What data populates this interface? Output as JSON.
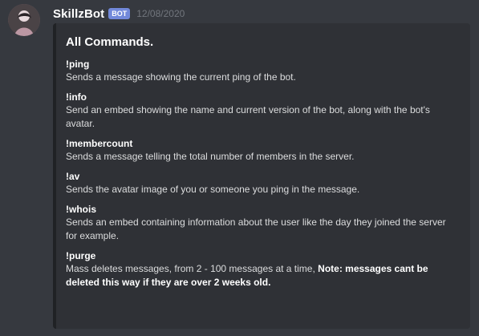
{
  "message": {
    "author": "SkillzBot",
    "bot_tag": "BOT",
    "timestamp": "12/08/2020"
  },
  "embed": {
    "title": "All Commands.",
    "commands": [
      {
        "name": "!ping",
        "description": "Sends a message showing the current ping of the bot."
      },
      {
        "name": "!info",
        "description": "Send an embed showing the name and current version of the bot, along with the bot's avatar."
      },
      {
        "name": "!membercount",
        "description": "Sends a message telling the total number of members in the server."
      },
      {
        "name": "!av",
        "description": "Sends the avatar image of you or someone you ping in the message."
      },
      {
        "name": "!whois",
        "description": "Sends an embed containing information about the user like the day they joined the server for example."
      },
      {
        "name": "!purge",
        "description": "Mass deletes messages, from 2 - 100 messages at a time,",
        "note": "Note: messages cant be deleted this way if they are over 2 weeks old."
      }
    ]
  },
  "colors": {
    "background": "#36393f",
    "embed_background": "#2f3136",
    "embed_border": "#202225",
    "bot_tag": "#7289da",
    "timestamp": "#72767d",
    "text": "#dcddde",
    "heading": "#ffffff"
  },
  "icons": {
    "avatar": "user-avatar-icon"
  }
}
